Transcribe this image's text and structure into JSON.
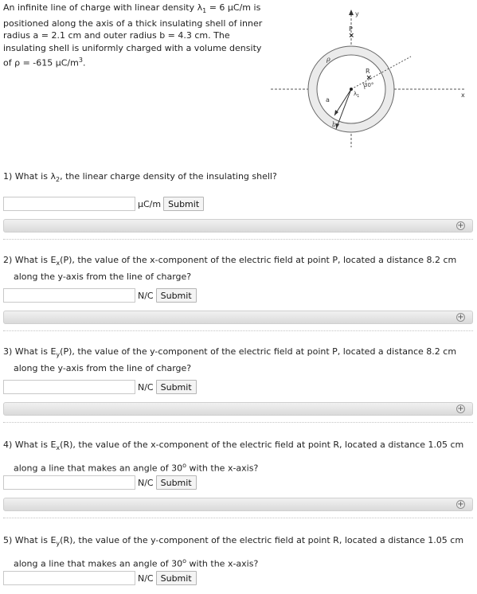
{
  "intro": {
    "text_a": "An infinite line of charge with linear density λ",
    "sub_1": "1",
    "text_b": " = 6 μC/m is positioned along the axis of a thick insulating shell of inner radius a = 2.1 cm and outer radius b = 4.3 cm. The insulating shell is uniformly charged with a volume density of ρ = -615 μC/m",
    "sup_3": "3",
    "text_c": "."
  },
  "diagram": {
    "label_y": "y",
    "label_x": "x",
    "label_P": "P",
    "label_R": "R",
    "label_rho": "ρ",
    "label_a": "a",
    "label_b": "b",
    "label_lambda": "λ",
    "label_lambda_sub": "1",
    "label_angle": "30°"
  },
  "questions": [
    {
      "pre": "1) What is λ",
      "sub": "2",
      "post": ", the linear charge density of the insulating shell?",
      "line2": "",
      "unit": "μC/m",
      "submit": "Submit",
      "value": ""
    },
    {
      "pre": "2) What is E",
      "sub": "x",
      "post": "(P), the value of the x-component of the electric field at point P, located a distance 8.2 cm",
      "line2": "along the y-axis from the line of charge?",
      "unit": "N/C",
      "submit": "Submit",
      "value": ""
    },
    {
      "pre": "3) What is E",
      "sub": "y",
      "post": "(P), the value of the y-component of the electric field at point P, located a distance 8.2 cm",
      "line2": "along the y-axis from the line of charge?",
      "unit": "N/C",
      "submit": "Submit",
      "value": ""
    },
    {
      "pre": "4) What is E",
      "sub": "x",
      "post": "(R), the value of the x-component of the electric field at point R, located a distance 1.05 cm",
      "line2a": "along a line that makes an angle of 30",
      "line2sup": "o",
      "line2b": " with the x-axis?",
      "unit": "N/C",
      "submit": "Submit",
      "value": ""
    },
    {
      "pre": "5) What is E",
      "sub": "y",
      "post": "(R), the value of the y-component of the electric field at point R, located a distance 1.05 cm",
      "line2a": "along a line that makes an angle of 30",
      "line2sup": "o",
      "line2b": " with the x-axis?",
      "unit": "N/C",
      "submit": "Submit",
      "value": ""
    }
  ],
  "expand_icon": "+"
}
